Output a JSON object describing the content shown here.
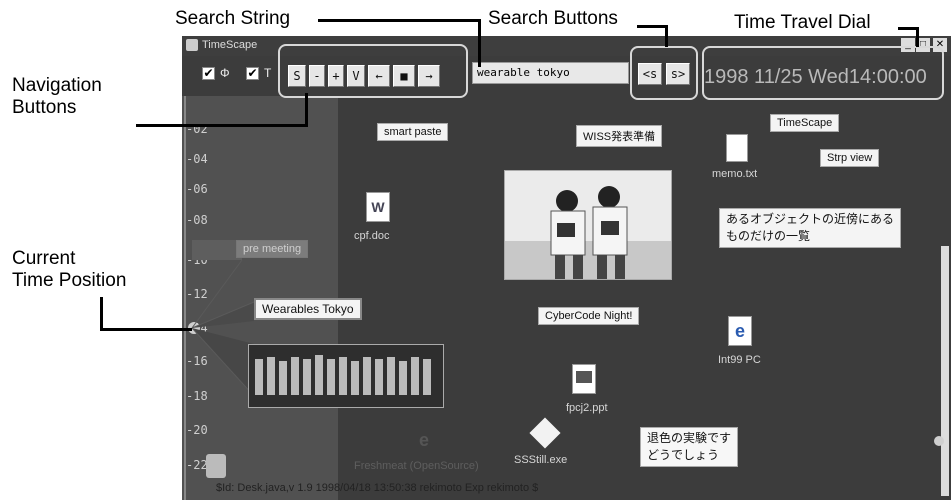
{
  "callouts": {
    "search_string": "Search String",
    "search_buttons": "Search Buttons",
    "time_travel_dial": "Time Travel Dial",
    "navigation_buttons_1": "Navigation",
    "navigation_buttons_2": "Buttons",
    "current_time_1": "Current",
    "current_time_2": "Time Position"
  },
  "window": {
    "title": "TimeScape",
    "controls": [
      "_",
      "□",
      "✕"
    ]
  },
  "toolbar": {
    "check1_label": "Φ",
    "check2_label": "T",
    "nav_buttons": [
      "S",
      "-",
      "+",
      "V",
      "←",
      "■",
      "→"
    ],
    "search_value": "wearable tokyo",
    "search_back": "<s",
    "search_fwd": "s>",
    "dial_text": "1998 11/25 Wed14:00:00"
  },
  "timeline": {
    "ticks": [
      "-02",
      "-04",
      "-06",
      "-08",
      "-10",
      "-12",
      "-14",
      "-16",
      "-18",
      "-20",
      "-22"
    ]
  },
  "desk": {
    "labels": {
      "smart_paste": "smart paste",
      "wiss": "WISS発表準備",
      "timescape": "TimeScape",
      "strp_view": "Strp view",
      "neighbors_1": "あるオブジェクトの近傍にある",
      "neighbors_2": "ものだけの一覧",
      "pre_meeting": "pre meeting",
      "wearables_tokyo": "Wearables Tokyo",
      "cybercode": "CyberCode Night!",
      "fade_1": "退色の実験です",
      "fade_2": "どうでしょう"
    },
    "icons": {
      "memo": "memo.txt",
      "cpf": "cpf.doc",
      "int99": "Int99 PC",
      "fpcj2": "fpcj2.ppt",
      "freshmeat": "Freshmeat (OpenSource)",
      "ssstill": "SSStill.exe"
    },
    "footer": "$Id: Desk.java,v 1.9 1998/04/18 13:50:38 rekimoto Exp rekimoto $"
  }
}
